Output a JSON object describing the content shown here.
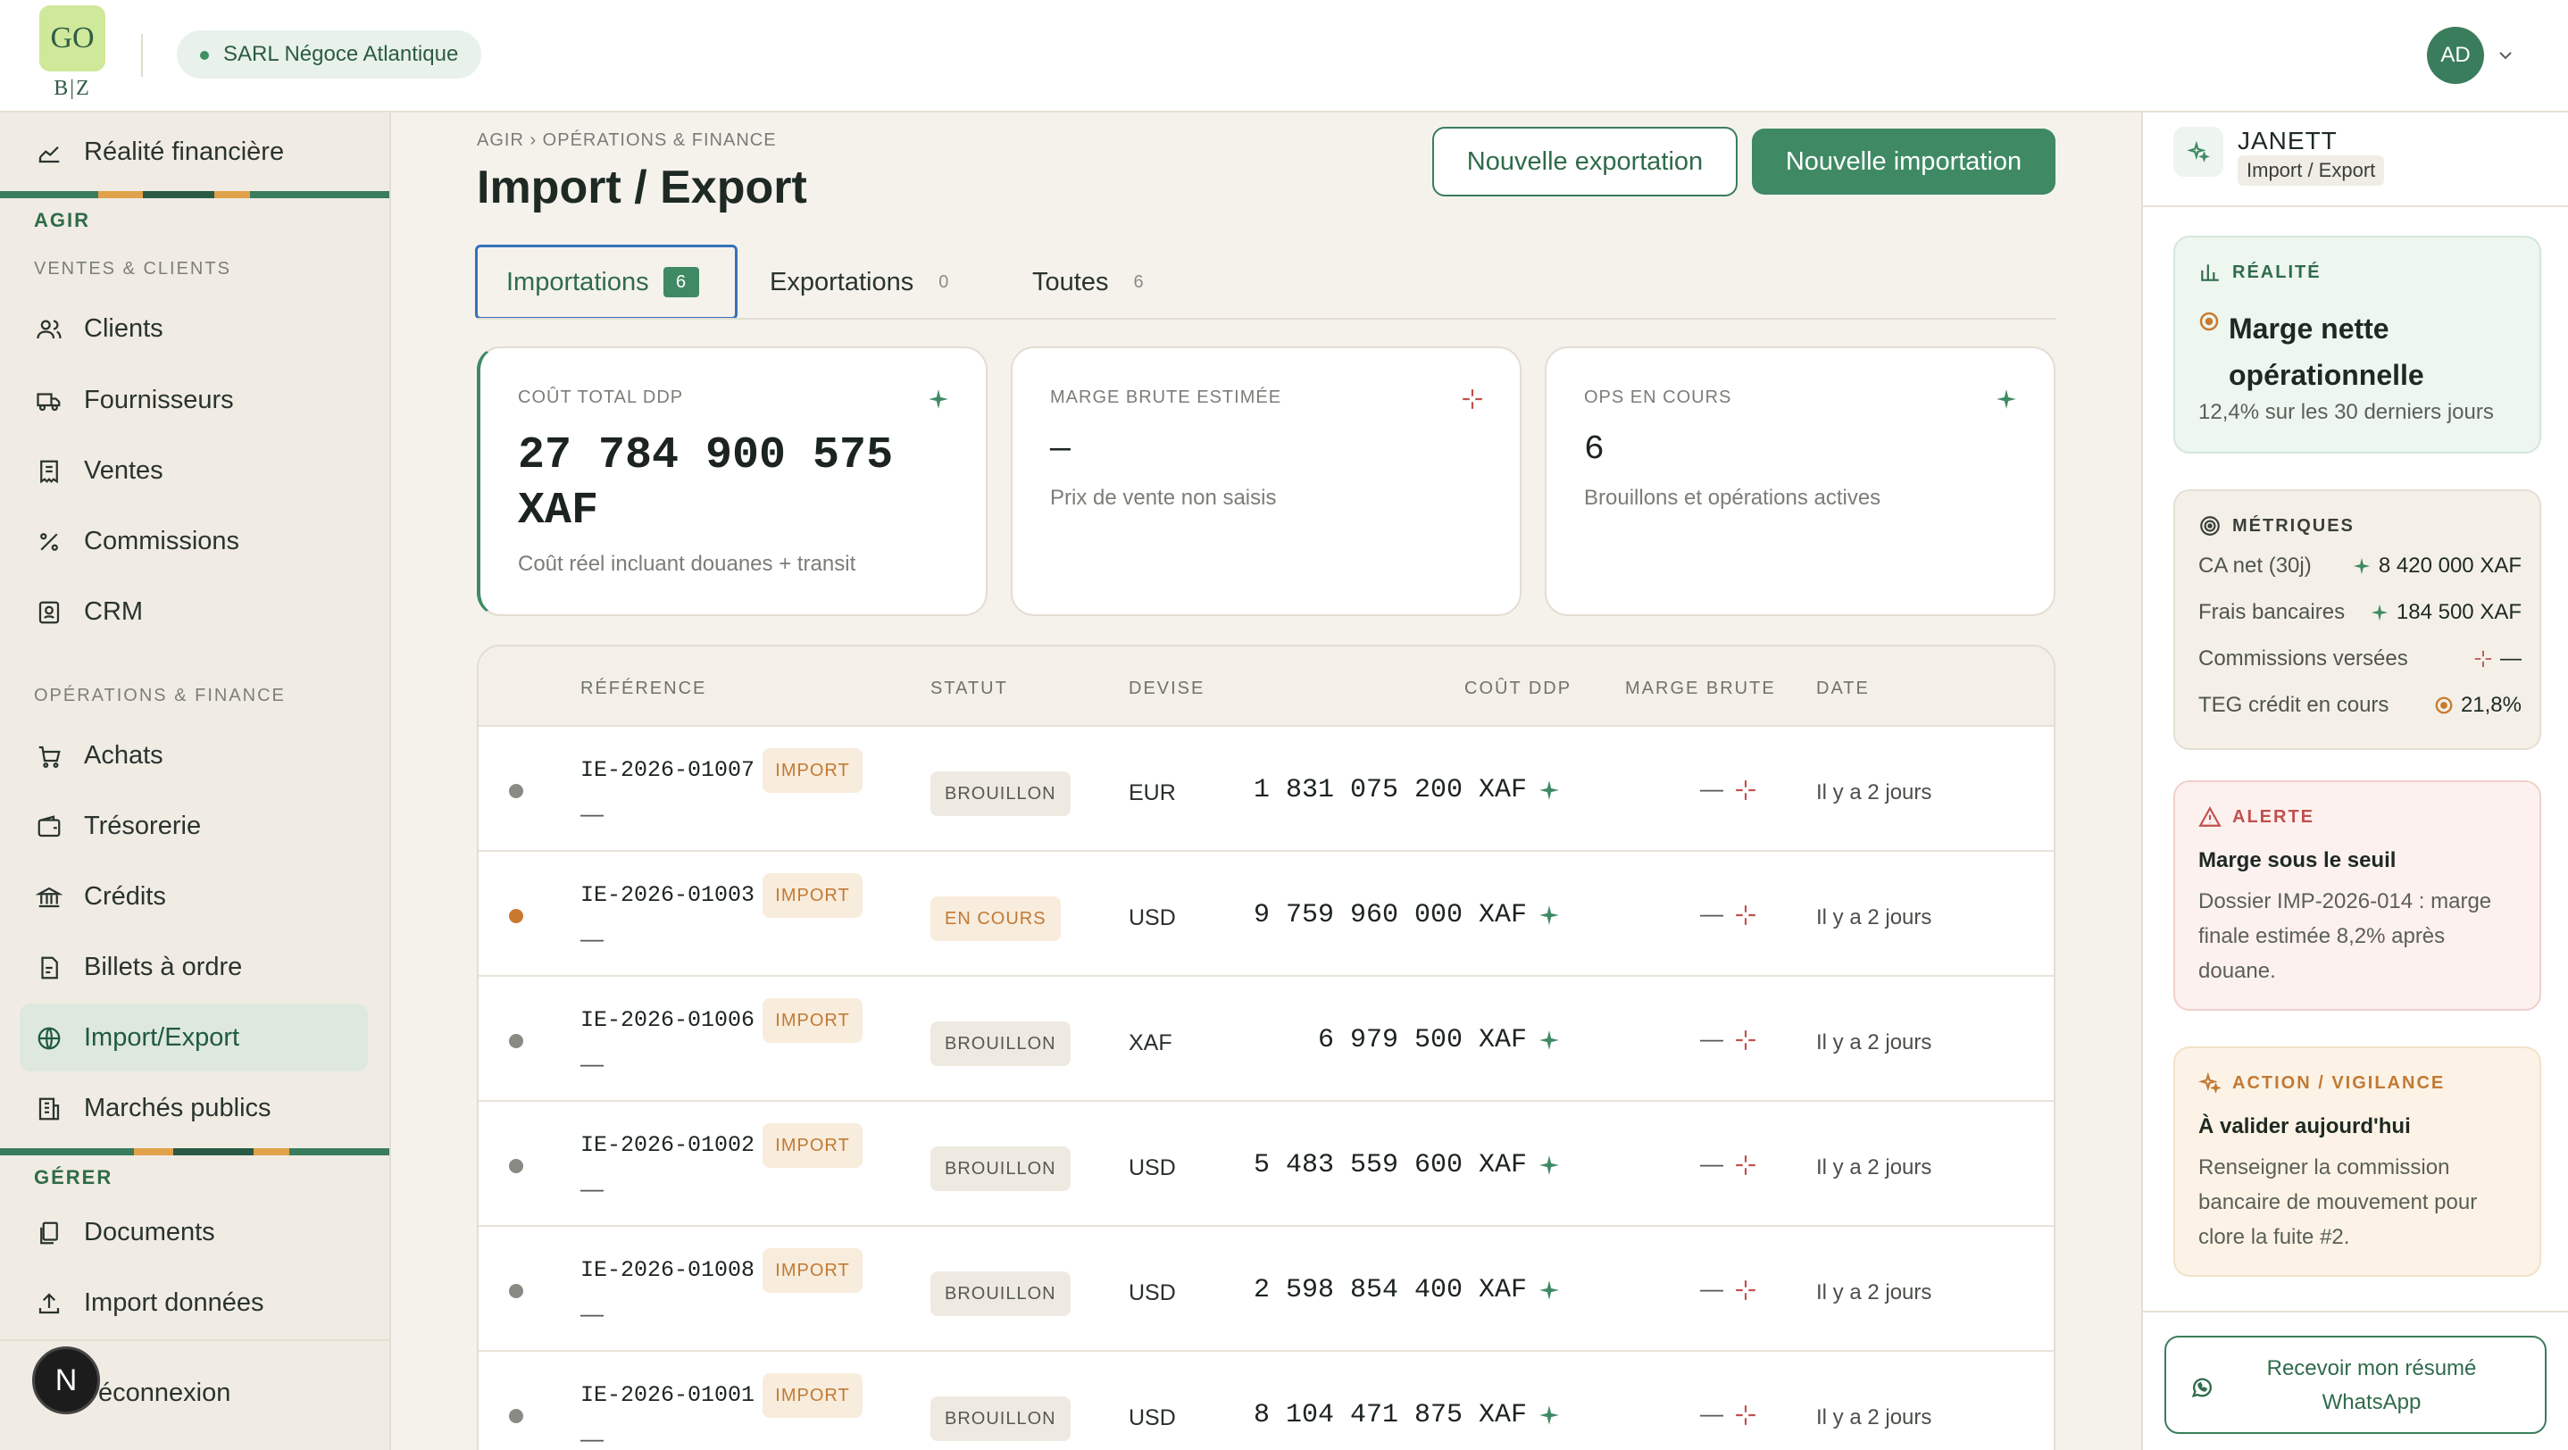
{
  "brand": {
    "logo_top": "GO",
    "logo_bottom": "B|Z"
  },
  "company": {
    "name": "SARL Négoce Atlantique"
  },
  "user": {
    "initials": "AD"
  },
  "sidebar": {
    "top_item": "Réalité financière",
    "agir_label": "AGIR",
    "ventes_label": "VENTES & CLIENTS",
    "ventes_items": [
      "Clients",
      "Fournisseurs",
      "Ventes",
      "Commissions",
      "CRM"
    ],
    "ops_label": "OPÉRATIONS & FINANCE",
    "ops_items": [
      "Achats",
      "Trésorerie",
      "Crédits",
      "Billets à ordre",
      "Import/Export",
      "Marchés publics"
    ],
    "gerer_label": "GÉRER",
    "gerer_items": [
      "Documents",
      "Import données"
    ],
    "logout": "éconnexion",
    "n_badge": "N"
  },
  "page": {
    "breadcrumb": "AGIR › OPÉRATIONS & FINANCE",
    "title": "Import / Export",
    "btn_export": "Nouvelle exportation",
    "btn_import": "Nouvelle importation"
  },
  "tabs": [
    {
      "label": "Importations",
      "count": "6"
    },
    {
      "label": "Exportations",
      "count": "0"
    },
    {
      "label": "Toutes",
      "count": "6"
    }
  ],
  "kpis": [
    {
      "label": "COÛT TOTAL DDP",
      "value_line1": "27 784 900 575",
      "value_line2": "XAF",
      "sub": "Coût réel incluant douanes + transit"
    },
    {
      "label": "MARGE BRUTE ESTIMÉE",
      "value": "—",
      "sub": "Prix de vente non saisis"
    },
    {
      "label": "OPS EN COURS",
      "value": "6",
      "sub": "Brouillons et opérations actives"
    }
  ],
  "table": {
    "headers": [
      "RÉFÉRENCE",
      "STATUT",
      "DEVISE",
      "COÛT DDP",
      "MARGE BRUTE",
      "DATE"
    ],
    "rows": [
      {
        "ref": "IE-2026-01007",
        "sub": "—",
        "tag": "IMPORT",
        "status": "BROUILLON",
        "devise": "EUR",
        "cost": "1 831 075 200 XAF",
        "marge": "—",
        "date": "Il y a 2 jours",
        "dot": "#8a8a85"
      },
      {
        "ref": "IE-2026-01003",
        "sub": "—",
        "tag": "IMPORT",
        "status": "EN COURS",
        "devise": "USD",
        "cost": "9 759 960 000 XAF",
        "marge": "—",
        "date": "Il y a 2 jours",
        "dot": "#c9792d"
      },
      {
        "ref": "IE-2026-01006",
        "sub": "—",
        "tag": "IMPORT",
        "status": "BROUILLON",
        "devise": "XAF",
        "cost": "6 979 500 XAF",
        "marge": "—",
        "date": "Il y a 2 jours",
        "dot": "#8a8a85"
      },
      {
        "ref": "IE-2026-01002",
        "sub": "—",
        "tag": "IMPORT",
        "status": "BROUILLON",
        "devise": "USD",
        "cost": "5 483 559 600 XAF",
        "marge": "—",
        "date": "Il y a 2 jours",
        "dot": "#8a8a85"
      },
      {
        "ref": "IE-2026-01008",
        "sub": "—",
        "tag": "IMPORT",
        "status": "BROUILLON",
        "devise": "USD",
        "cost": "2 598 854 400 XAF",
        "marge": "—",
        "date": "Il y a 2 jours",
        "dot": "#8a8a85"
      },
      {
        "ref": "IE-2026-01001",
        "sub": "—",
        "tag": "IMPORT",
        "status": "BROUILLON",
        "devise": "USD",
        "cost": "8 104 471 875 XAF",
        "marge": "—",
        "date": "Il y a 2 jours",
        "dot": "#8a8a85"
      }
    ]
  },
  "assistant": {
    "name": "JANETT",
    "context": "Import / Export",
    "realite": {
      "label": "RÉALITÉ",
      "title_line1": "Marge nette",
      "title_line2": "opérationnelle",
      "text": "12,4% sur les 30 derniers jours"
    },
    "metriques": {
      "label": "MÉTRIQUES",
      "rows": [
        {
          "label": "CA net (30j)",
          "value": "8 420 000 XAF"
        },
        {
          "label": "Frais bancaires",
          "value": "184 500 XAF"
        },
        {
          "label": "Commissions versées",
          "value": "—"
        },
        {
          "label": "TEG crédit en cours",
          "value": "21,8%"
        }
      ]
    },
    "alerte": {
      "label": "ALERTE",
      "title": "Marge sous le seuil",
      "text": "Dossier IMP-2026-014 : marge finale estimée 8,2% après douane."
    },
    "action": {
      "label": "ACTION / VIGILANCE",
      "title": "À valider aujourd'hui",
      "text": "Renseigner la commission bancaire de mouvement pour clore la fuite #2."
    },
    "whatsapp_btn": "Recevoir mon résumé WhatsApp"
  },
  "colors": {
    "accent": "#3f8a64",
    "import_tag": "#c17a34",
    "alert": "#c0504d"
  }
}
